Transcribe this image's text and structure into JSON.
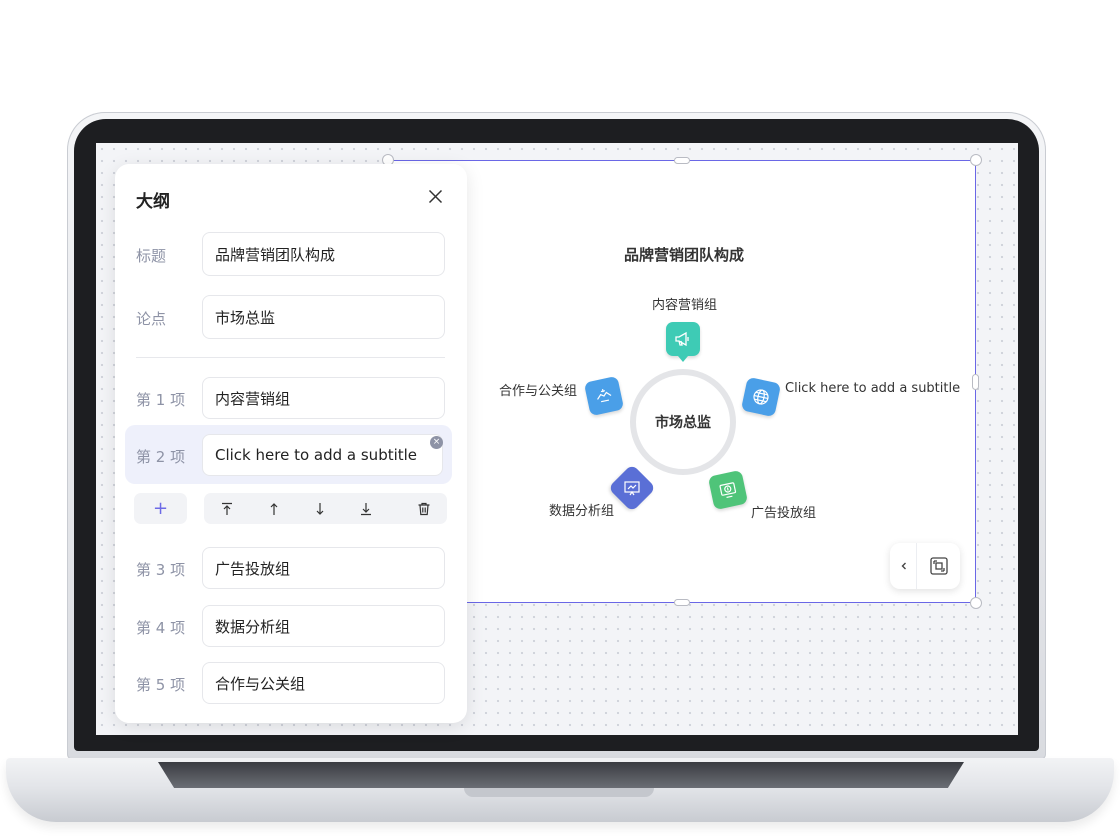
{
  "outline_panel": {
    "title": "大纲",
    "rows": [
      {
        "label": "标题",
        "value": "品牌营销团队构成"
      },
      {
        "label": "论点",
        "value": "市场总监"
      },
      {
        "label": "第 1 项",
        "value": "内容营销组"
      },
      {
        "label": "第 2 项",
        "value": "Click here to add a subtitle"
      },
      {
        "label": "第 3 项",
        "value": "广告投放组"
      },
      {
        "label": "第 4 项",
        "value": "数据分析组"
      },
      {
        "label": "第 5 项",
        "value": "合作与公关组"
      }
    ],
    "add_label": "+",
    "clear_label": "×"
  },
  "slide": {
    "title": "品牌营销团队构成",
    "center": "市场总监",
    "nodes": [
      {
        "label": "内容营销组",
        "icon": "megaphone-icon",
        "color": "#3ecbb5"
      },
      {
        "label": "Click here to add a subtitle",
        "icon": "globe-icon",
        "color": "#4a9fe8"
      },
      {
        "label": "广告投放组",
        "icon": "money-screen-icon",
        "color": "#4fc479"
      },
      {
        "label": "数据分析组",
        "icon": "chart-board-icon",
        "color": "#5a6fd6"
      },
      {
        "label": "合作与公关组",
        "icon": "handshake-icon",
        "color": "#4a9fe8"
      }
    ]
  },
  "colors": {
    "accent": "#6a67e6",
    "muted_label": "#8e93a6"
  }
}
